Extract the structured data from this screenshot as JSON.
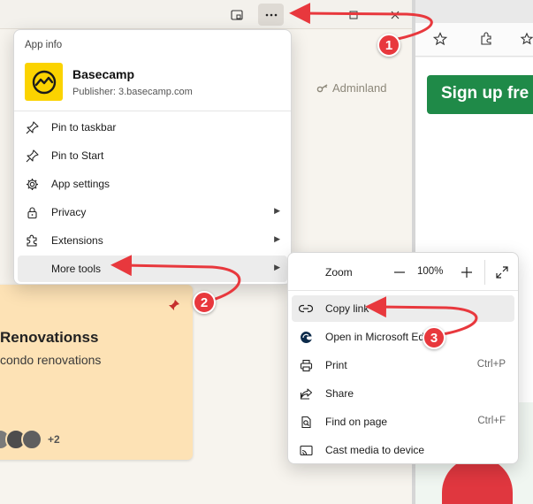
{
  "app_window": {
    "adminland_label": "Adminland",
    "project": {
      "title": "Renovationss",
      "description": "condo renovations",
      "extra_members": "+2"
    }
  },
  "browser": {
    "signup_label": "Sign up fre"
  },
  "app_menu": {
    "section_label": "App info",
    "app_name": "Basecamp",
    "publisher": "Publisher: 3.basecamp.com",
    "items": [
      {
        "label": "Pin to taskbar",
        "icon": "pin-icon"
      },
      {
        "label": "Pin to Start",
        "icon": "pin-icon"
      },
      {
        "label": "App settings",
        "icon": "gear-icon"
      },
      {
        "label": "Privacy",
        "icon": "lock-icon",
        "submenu": true
      },
      {
        "label": "Extensions",
        "icon": "puzzle-icon",
        "submenu": true
      },
      {
        "label": "More tools",
        "icon": "",
        "submenu": true
      }
    ]
  },
  "tools_menu": {
    "zoom_label": "Zoom",
    "zoom_value": "100%",
    "items": [
      {
        "label": "Copy link",
        "icon": "link-icon",
        "shortcut": ""
      },
      {
        "label": "Open in Microsoft Ed",
        "icon": "edge-icon",
        "shortcut": ""
      },
      {
        "label": "Print",
        "icon": "printer-icon",
        "shortcut": "Ctrl+P"
      },
      {
        "label": "Share",
        "icon": "share-icon",
        "shortcut": ""
      },
      {
        "label": "Find on page",
        "icon": "find-icon",
        "shortcut": "Ctrl+F"
      },
      {
        "label": "Cast media to device",
        "icon": "cast-icon",
        "shortcut": ""
      }
    ]
  },
  "annotations": {
    "step_1": "1",
    "step_2": "2",
    "step_3": "3",
    "accent_color": "#e8383d"
  }
}
